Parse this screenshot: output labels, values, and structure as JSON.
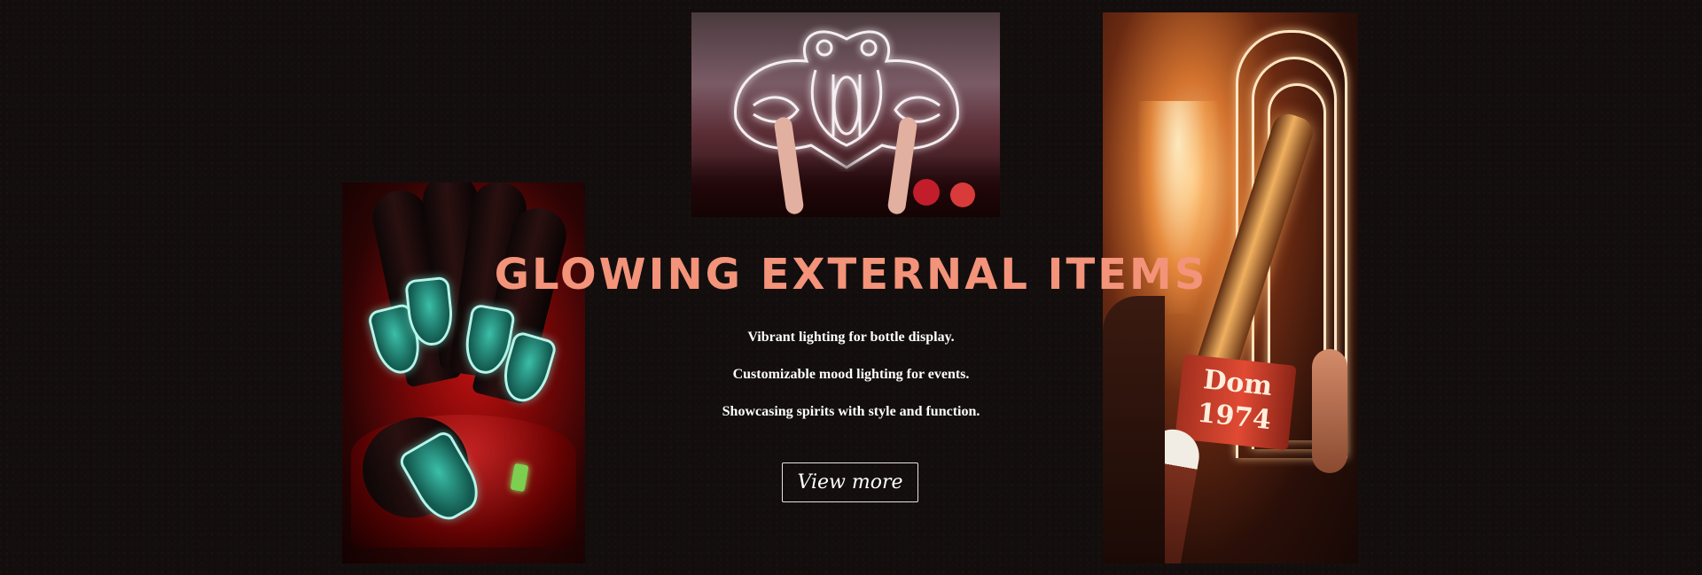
{
  "section": {
    "heading": "GLOWING EXTERNAL ITEMS",
    "lines": [
      "Vibrant lighting for bottle display.",
      "Customizable mood lighting for events.",
      "Showcasing spirits with style and function."
    ],
    "button_label": "View more"
  },
  "photos": {
    "left": {
      "label_text": ""
    },
    "top": {
      "label_text": ""
    },
    "right": {
      "label_text": "Dom 1974"
    }
  },
  "colors": {
    "background": "#120e0e",
    "heading": "#f39379",
    "text": "#ffffff",
    "button_border": "#e9e2e2"
  }
}
